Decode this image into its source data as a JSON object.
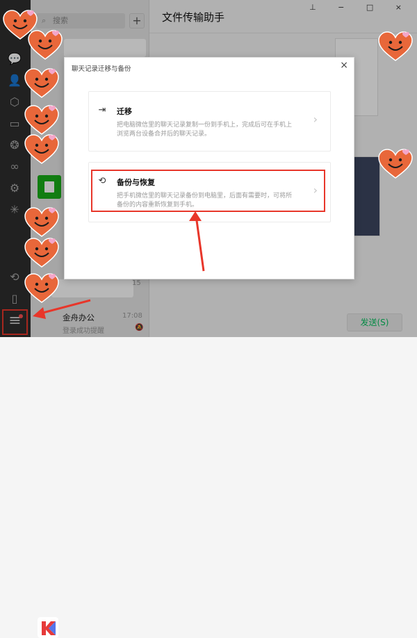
{
  "colors": {
    "accent": "#07c160",
    "sidebar_bg": "#2e2e2e",
    "highlight_red": "#e8362a",
    "heart_fill": "#e8673a"
  },
  "sidebar": {
    "icons": [
      "chat-icon",
      "contacts-icon",
      "box-icon",
      "folder-icon",
      "moments-icon",
      "miniprogram-icon",
      "settings-gear-icon",
      "channels-icon",
      "sync-icon",
      "phone-icon",
      "menu-icon"
    ]
  },
  "chatlist": {
    "search_placeholder": "搜索",
    "add_label": "+",
    "visible_time": "15",
    "jz": {
      "name": "金舟办公",
      "time": "17:08",
      "message": "登录成功提醒"
    }
  },
  "main": {
    "title": "文件传输助手",
    "send_label": "发送(S)"
  },
  "dialog": {
    "title": "聊天记录迁移与备份",
    "close_label": "×",
    "options": [
      {
        "title": "迁移",
        "desc": "把电脑微信里的聊天记录复制一份到手机上，完成后可在手机上浏览两台设备合并后的聊天记录。",
        "arrow": "›"
      },
      {
        "title": "备份与恢复",
        "desc": "把手机微信里的聊天记录备份到电脑里，后面有需要时，可将所备份的内容重新恢复到手机。",
        "arrow": "›"
      }
    ]
  },
  "window_controls": "⊥ − □ ×"
}
